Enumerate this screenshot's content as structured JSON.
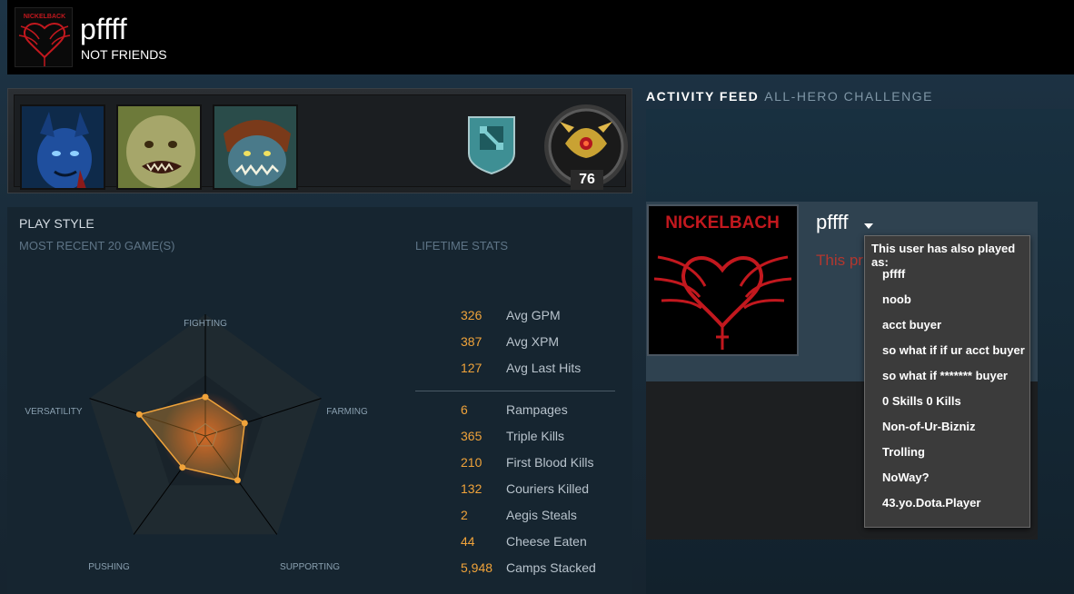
{
  "header": {
    "username": "pffff",
    "friend_status": "NOT FRIENDS",
    "avatar_logo_text": "NICKELBACK"
  },
  "hero_bar": {
    "heroes": [
      "night-stalker",
      "pudge",
      "slark"
    ],
    "level": "76"
  },
  "play_style": {
    "title": "PLAY STYLE",
    "subtitle": "MOST RECENT 20 GAME(S)",
    "axes": [
      "FIGHTING",
      "FARMING",
      "SUPPORTING",
      "PUSHING",
      "VERSATILITY"
    ],
    "levels": [
      0.32,
      0.34,
      0.45,
      0.32,
      0.57
    ],
    "accent_color": "#f0a33a"
  },
  "lifetime_stats": {
    "title": "LIFETIME STATS",
    "averages": [
      {
        "value": "326",
        "label": "Avg GPM"
      },
      {
        "value": "387",
        "label": "Avg XPM"
      },
      {
        "value": "127",
        "label": "Avg Last Hits"
      }
    ],
    "totals": [
      {
        "value": "6",
        "label": "Rampages"
      },
      {
        "value": "365",
        "label": "Triple Kills"
      },
      {
        "value": "210",
        "label": "First Blood Kills"
      },
      {
        "value": "132",
        "label": "Couriers Killed"
      },
      {
        "value": "2",
        "label": "Aegis Steals"
      },
      {
        "value": "44",
        "label": "Cheese Eaten"
      },
      {
        "value": "5,948",
        "label": "Camps Stacked"
      }
    ]
  },
  "activity_feed": {
    "tab_active": "ACTIVITY FEED",
    "tab_other": "ALL-HERO CHALLENGE"
  },
  "profile_card": {
    "persona_name": "pffff",
    "private_text": "This pr",
    "avatar_logo_text": "NICKELBACH"
  },
  "alias_popup": {
    "heading": "This user has also played as:",
    "aliases": [
      "pffff",
      "noob",
      "acct buyer",
      "so what if if ur acct buyer",
      "so what if ******* buyer",
      "0 Skills 0 Kills",
      "Non-of-Ur-Bizniz",
      "Trolling",
      "NoWay?",
      "43.yo.Dota.Player"
    ]
  }
}
